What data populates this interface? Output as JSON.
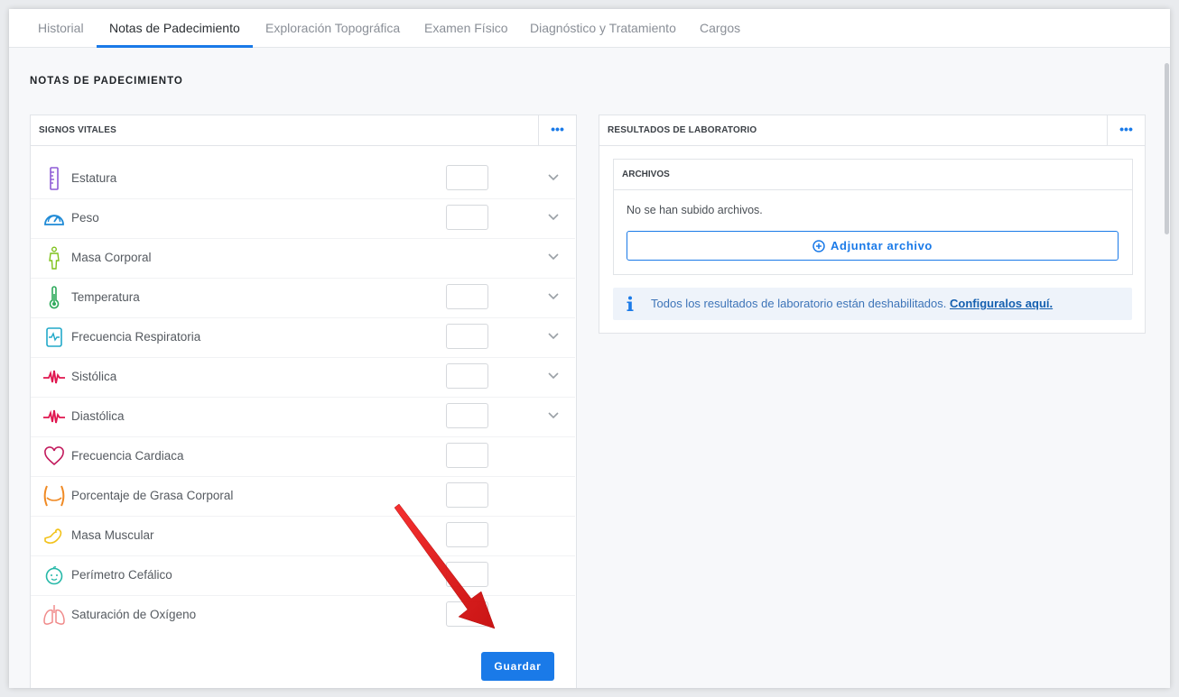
{
  "tabs": [
    {
      "label": "Historial",
      "active": false
    },
    {
      "label": "Notas de Padecimiento",
      "active": true
    },
    {
      "label": "Exploración Topográfica",
      "active": false
    },
    {
      "label": "Examen Físico",
      "active": false
    },
    {
      "label": "Diagnóstico y Tratamiento",
      "active": false
    },
    {
      "label": "Cargos",
      "active": false
    }
  ],
  "page_title": "NOTAS DE PADECIMIENTO",
  "vitals_panel": {
    "title": "SIGNOS VITALES",
    "menu_icon": "more-dots-icon",
    "items": [
      {
        "label": "Estatura",
        "icon": "ruler-icon",
        "color": "#8e5bd6",
        "has_input": true,
        "has_dropdown": true
      },
      {
        "label": "Peso",
        "icon": "scale-gauge-icon",
        "color": "#1f8ad6",
        "has_input": true,
        "has_dropdown": true
      },
      {
        "label": "Masa Corporal",
        "icon": "body-figure-icon",
        "color": "#7fc21b",
        "has_input": false,
        "has_dropdown": true
      },
      {
        "label": "Temperatura",
        "icon": "thermometer-icon",
        "color": "#2eaa5c",
        "has_input": true,
        "has_dropdown": true
      },
      {
        "label": "Frecuencia Respiratoria",
        "icon": "monitor-wave-icon",
        "color": "#22a9c9",
        "has_input": true,
        "has_dropdown": true
      },
      {
        "label": "Sistólica",
        "icon": "pulse-wave-icon",
        "color": "#e0154f",
        "has_input": true,
        "has_dropdown": true
      },
      {
        "label": "Diastólica",
        "icon": "pulse-wave-icon",
        "color": "#e0154f",
        "has_input": true,
        "has_dropdown": true
      },
      {
        "label": "Frecuencia Cardiaca",
        "icon": "heart-icon",
        "color": "#c2185b",
        "has_input": true,
        "has_dropdown": false
      },
      {
        "label": "Porcentaje de Grasa Corporal",
        "icon": "waist-icon",
        "color": "#f08a24",
        "has_input": true,
        "has_dropdown": false
      },
      {
        "label": "Masa Muscular",
        "icon": "muscle-arm-icon",
        "color": "#f2c21b",
        "has_input": true,
        "has_dropdown": false
      },
      {
        "label": "Perímetro Cefálico",
        "icon": "baby-head-icon",
        "color": "#26b8a8",
        "has_input": true,
        "has_dropdown": false
      },
      {
        "label": "Saturación de Oxígeno",
        "icon": "lungs-icon",
        "color": "#f08a8a",
        "has_input": true,
        "has_dropdown": false
      }
    ],
    "save_label": "Guardar"
  },
  "lab_panel": {
    "title": "RESULTADOS DE LABORATORIO",
    "menu_icon": "more-dots-icon",
    "files": {
      "title": "ARCHIVOS",
      "empty_text": "No se han subido archivos.",
      "attach_label": "Adjuntar archivo"
    },
    "info": {
      "text": "Todos los resultados de laboratorio están deshabilitados.",
      "link": "Configuralos aquí."
    }
  },
  "colors": {
    "accent": "#1a7ae8",
    "annotation_arrow": "#e01313"
  }
}
